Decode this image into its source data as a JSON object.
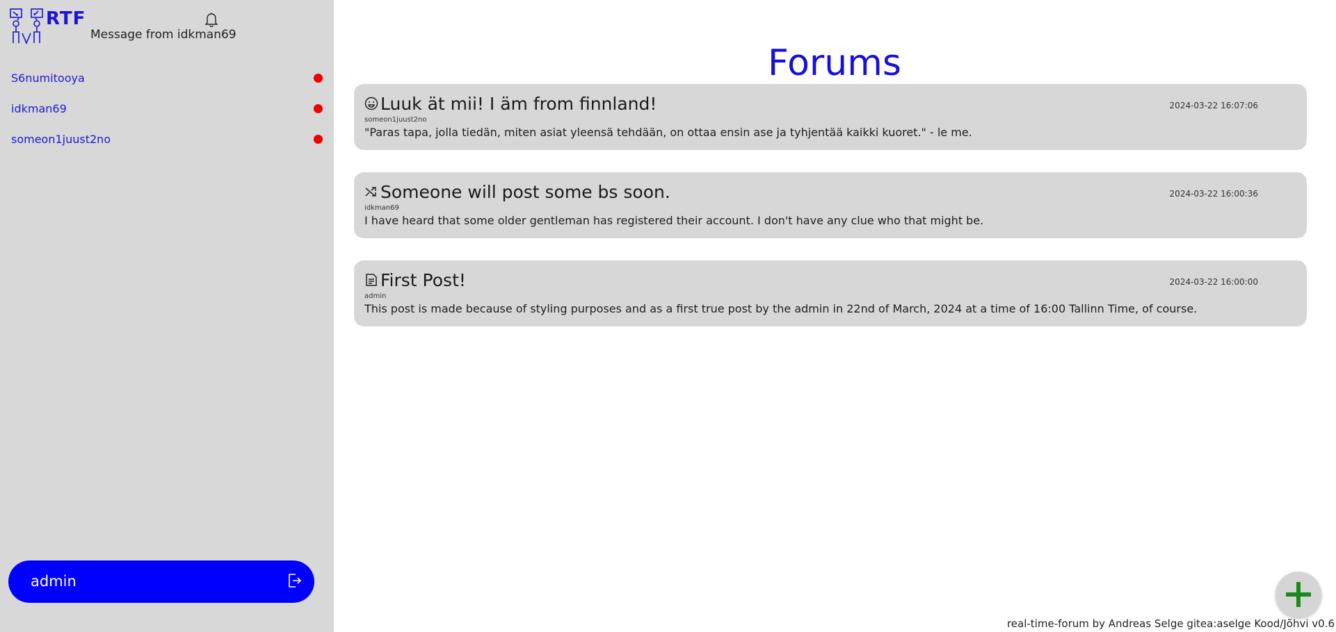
{
  "sidebar": {
    "brand_name": "RTF",
    "notification_message": "Message from idkman69",
    "users": [
      {
        "name": "S6numitooya",
        "status_color": "#ee0000"
      },
      {
        "name": "idkman69",
        "status_color": "#ee0000"
      },
      {
        "name": "someon1juust2no",
        "status_color": "#ee0000"
      }
    ],
    "current_user": "admin",
    "icons": {
      "logo": "forum-logo-icon",
      "bell": "bell-icon",
      "logout": "logout-icon"
    }
  },
  "main": {
    "title": "Forums",
    "posts": [
      {
        "icon": "smiley-icon",
        "title": "Luuk ät mii! I äm from finnland!",
        "date": "2024-03-22 16:07:06",
        "author": "someon1juust2no",
        "body": "\"Paras tapa, jolla tiedän, miten asiat yleensä tehdään, on ottaa ensin ase ja tyhjentää kaikki kuoret.\" - le me."
      },
      {
        "icon": "shuffle-icon",
        "title": "Someone will post some bs soon.",
        "date": "2024-03-22 16:00:36",
        "author": "idkman69",
        "body": "I have heard that some older gentleman has registered their account. I don't have any clue who that might be."
      },
      {
        "icon": "document-icon",
        "title": "First Post!",
        "date": "2024-03-22 16:00:00",
        "author": "admin",
        "body": "This post is made because of styling purposes and as a first true post by the admin in 22nd of March, 2024 at a time of 16:00 Tallinn Time, of course."
      }
    ],
    "add_button_icon": "plus-icon",
    "footer": "real-time-forum by Andreas Selge gitea:aselge Kood/Jõhvi v0.6"
  },
  "colors": {
    "accent": "#0000ff",
    "title_blue": "#1610d8",
    "sidebar_bg": "#d8d8d8",
    "card_bg": "#d7d7d7",
    "online_dot": "#ee0000",
    "fab_plus": "#1a8a1a"
  }
}
